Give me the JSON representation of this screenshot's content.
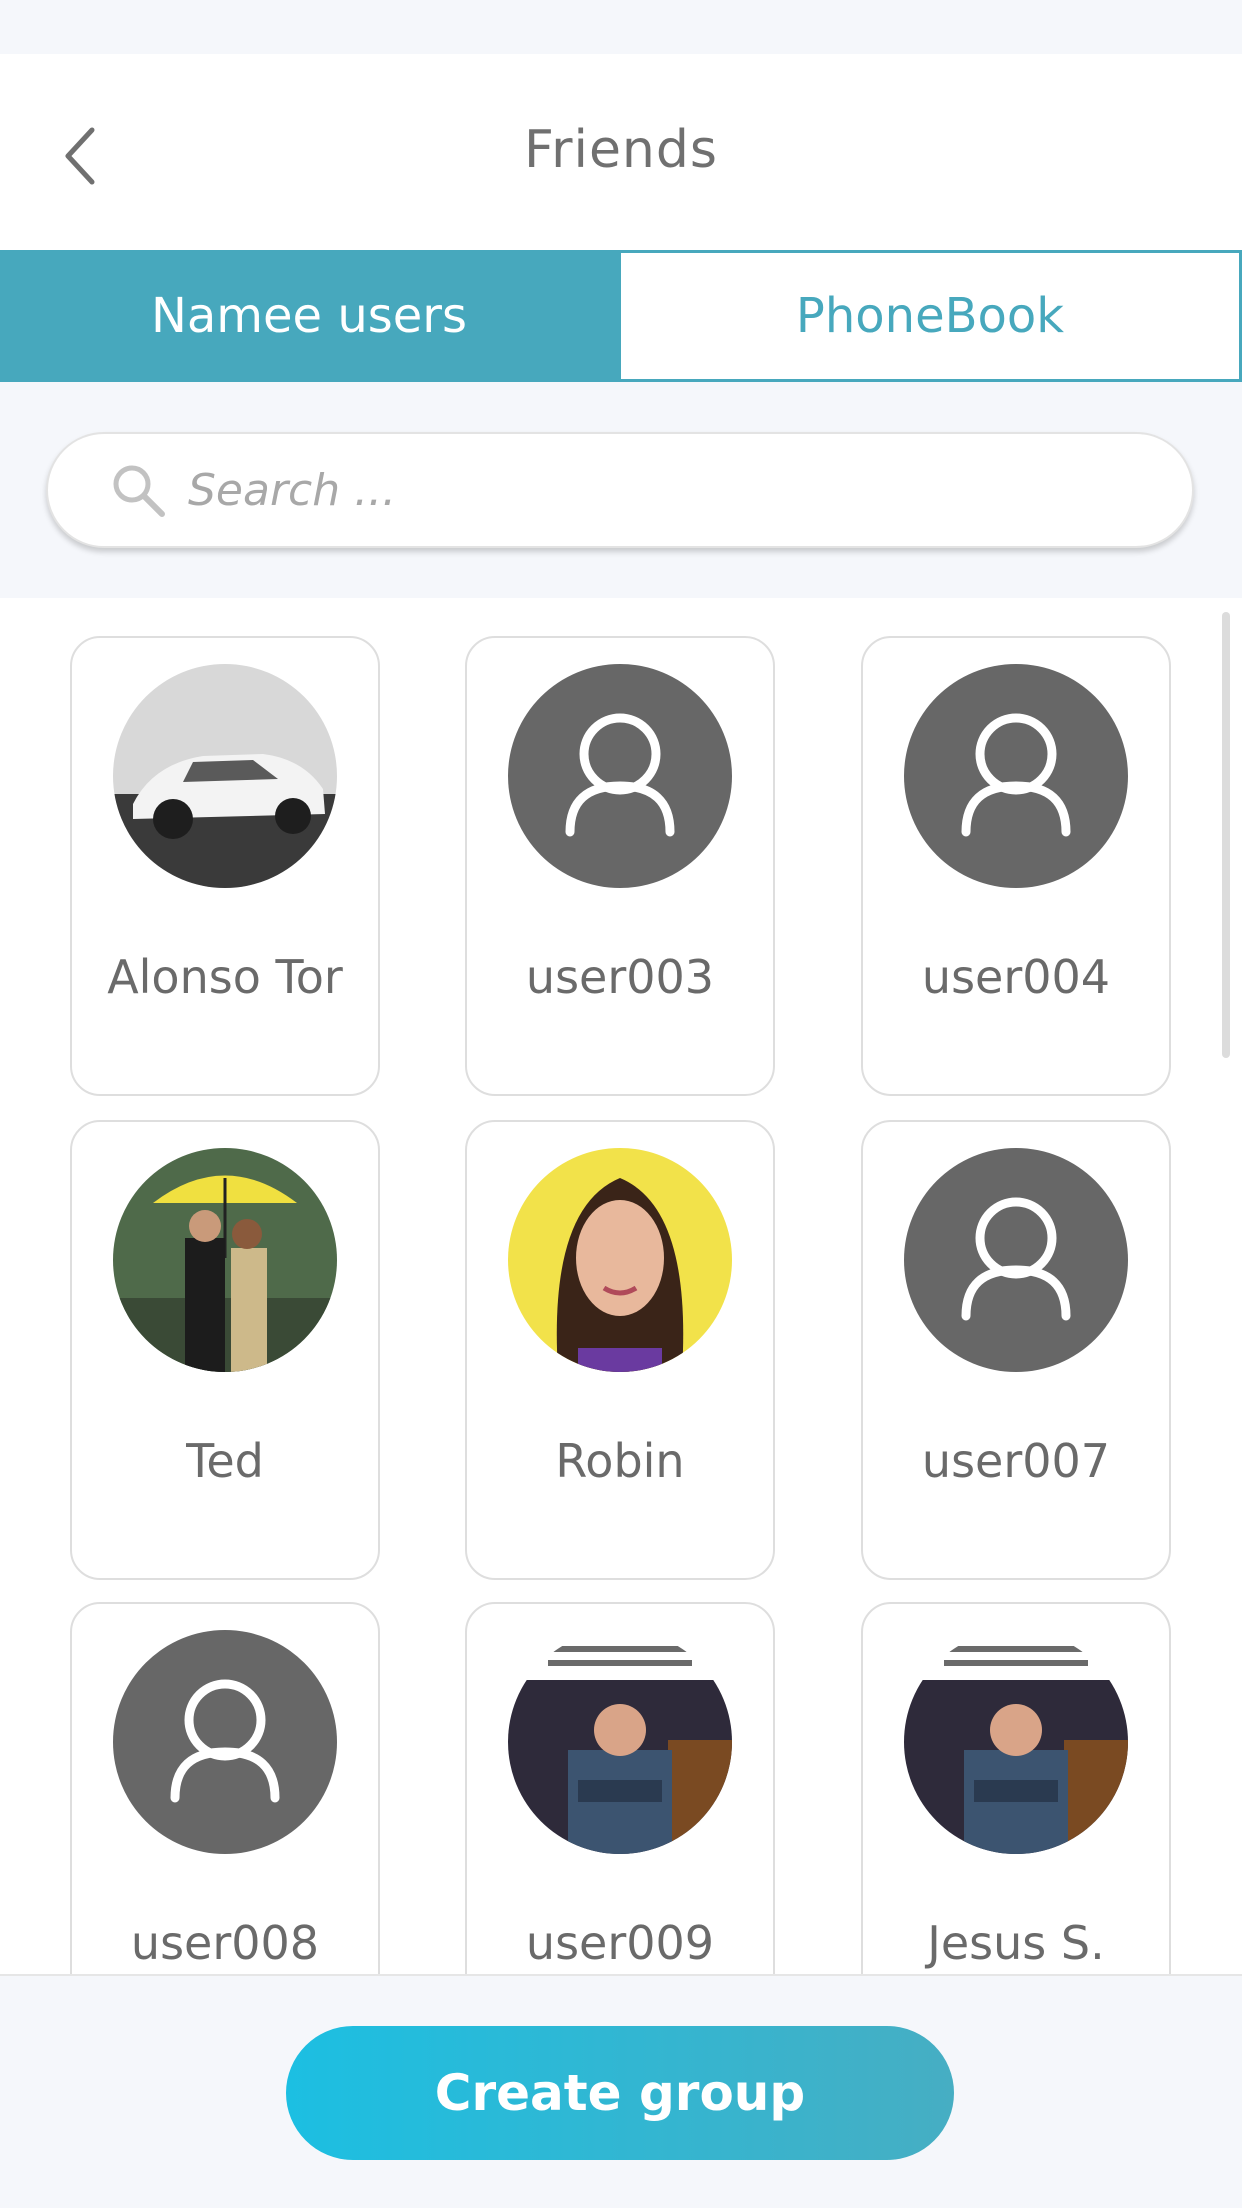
{
  "header": {
    "title": "Friends",
    "back_icon": "chevron-left-icon"
  },
  "tabs": [
    {
      "label": "Namee users",
      "active": true
    },
    {
      "label": "PhoneBook",
      "active": false
    }
  ],
  "search": {
    "placeholder": "Search ...",
    "icon": "search-icon"
  },
  "friends": [
    {
      "name": "Alonso Tor",
      "avatar": "photo-car"
    },
    {
      "name": "user003",
      "avatar": "default-user-icon"
    },
    {
      "name": "user004",
      "avatar": "default-user-icon"
    },
    {
      "name": "Ted",
      "avatar": "photo-couple-umbrella"
    },
    {
      "name": "Robin",
      "avatar": "photo-woman-portrait"
    },
    {
      "name": "user007",
      "avatar": "default-user-icon"
    },
    {
      "name": "user008",
      "avatar": "default-user-icon"
    },
    {
      "name": "user009",
      "avatar": "photo-meme-man"
    },
    {
      "name": "Jesus S.",
      "avatar": "photo-meme-man"
    }
  ],
  "footer": {
    "create_group_label": "Create group"
  },
  "colors": {
    "accent": "#47a8bd",
    "button_gradient_start": "#1cbfe2",
    "avatar_placeholder": "#676767"
  }
}
